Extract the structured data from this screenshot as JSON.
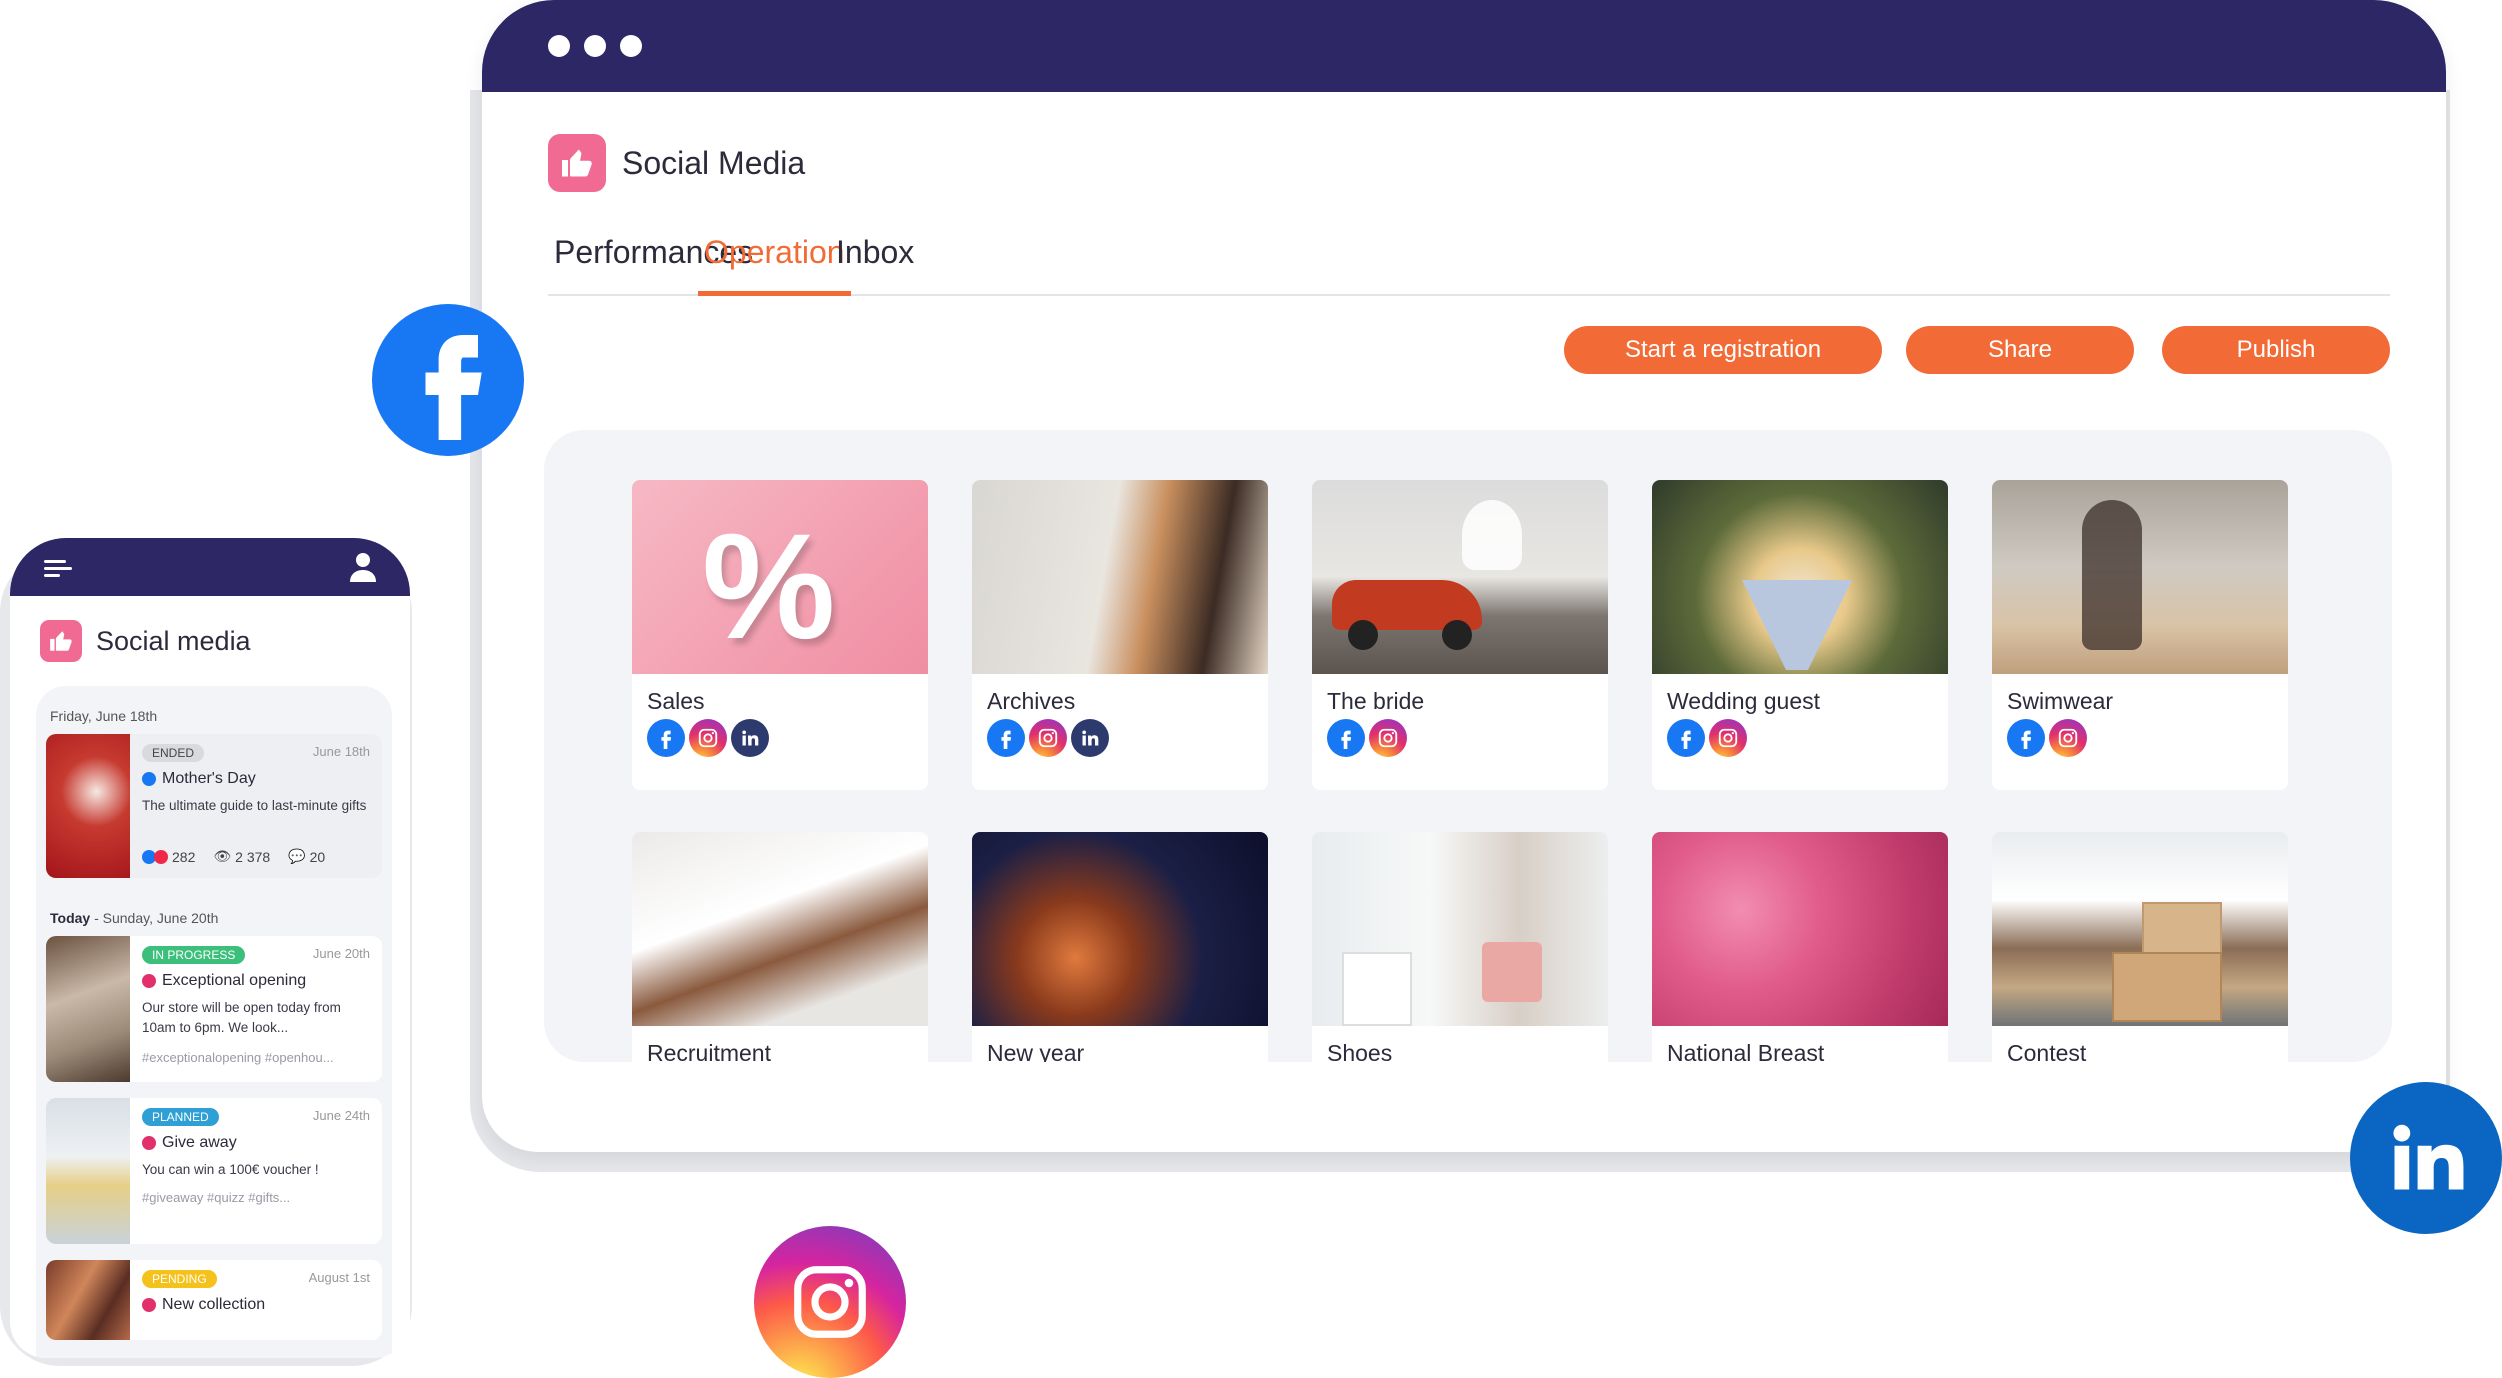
{
  "desktop": {
    "app_title": "Social Media",
    "tabs": [
      {
        "label": "Performances",
        "active": false
      },
      {
        "label": "Operation",
        "active": true
      },
      {
        "label": "Inbox",
        "active": false
      }
    ],
    "buttons": {
      "start_registration": "Start a registration",
      "share": "Share",
      "publish": "Publish"
    },
    "operations": [
      {
        "name": "Sales",
        "networks": [
          "facebook",
          "instagram",
          "linkedin"
        ]
      },
      {
        "name": "Archives",
        "networks": [
          "facebook",
          "instagram",
          "linkedin"
        ]
      },
      {
        "name": "The bride",
        "networks": [
          "facebook",
          "instagram"
        ]
      },
      {
        "name": "Wedding guest",
        "networks": [
          "facebook",
          "instagram"
        ]
      },
      {
        "name": "Swimwear",
        "networks": [
          "facebook",
          "instagram"
        ]
      },
      {
        "name": "Recruitment",
        "networks": []
      },
      {
        "name": "New year",
        "networks": []
      },
      {
        "name": "Shoes",
        "networks": []
      },
      {
        "name": "National Breast",
        "networks": []
      },
      {
        "name": "Contest",
        "networks": []
      }
    ]
  },
  "mobile": {
    "app_title": "Social media",
    "groups": [
      {
        "date": "Friday, June 18th"
      },
      {
        "date_prefix": "Today",
        "date": " - Sunday, June 20th"
      }
    ],
    "posts": [
      {
        "status": "ENDED",
        "date": "June 18th",
        "network": "facebook",
        "title": "Mother's Day",
        "description": "The ultimate guide to last-minute gifts",
        "likes": "282",
        "views": "2 378",
        "comments": "20"
      },
      {
        "status": "IN PROGRESS",
        "date": "June 20th",
        "network": "instagram",
        "title": "Exceptional opening",
        "description": "Our store will be open today from 10am to 6pm. We look...",
        "tags": "#exceptionalopening #openhou..."
      },
      {
        "status": "PLANNED",
        "date": "June 24th",
        "network": "instagram",
        "title": "Give away",
        "description": "You can win a 100€ voucher !",
        "tags": "#giveaway #quizz #gifts..."
      },
      {
        "status": "PENDING",
        "date": "August 1st",
        "network": "instagram",
        "title": "New collection"
      }
    ]
  },
  "colors": {
    "navy": "#2d2765",
    "accent": "#f26a35",
    "brand_pink": "#f06a93",
    "status_ended": "#d9dade",
    "status_in_progress": "#3bbf7a",
    "status_planned": "#2ea0d6",
    "status_pending": "#f5c21b",
    "facebook": "#1877f2",
    "linkedin": "#0a66c2"
  },
  "floating_icons": [
    "facebook-icon",
    "linkedin-icon",
    "instagram-icon"
  ]
}
